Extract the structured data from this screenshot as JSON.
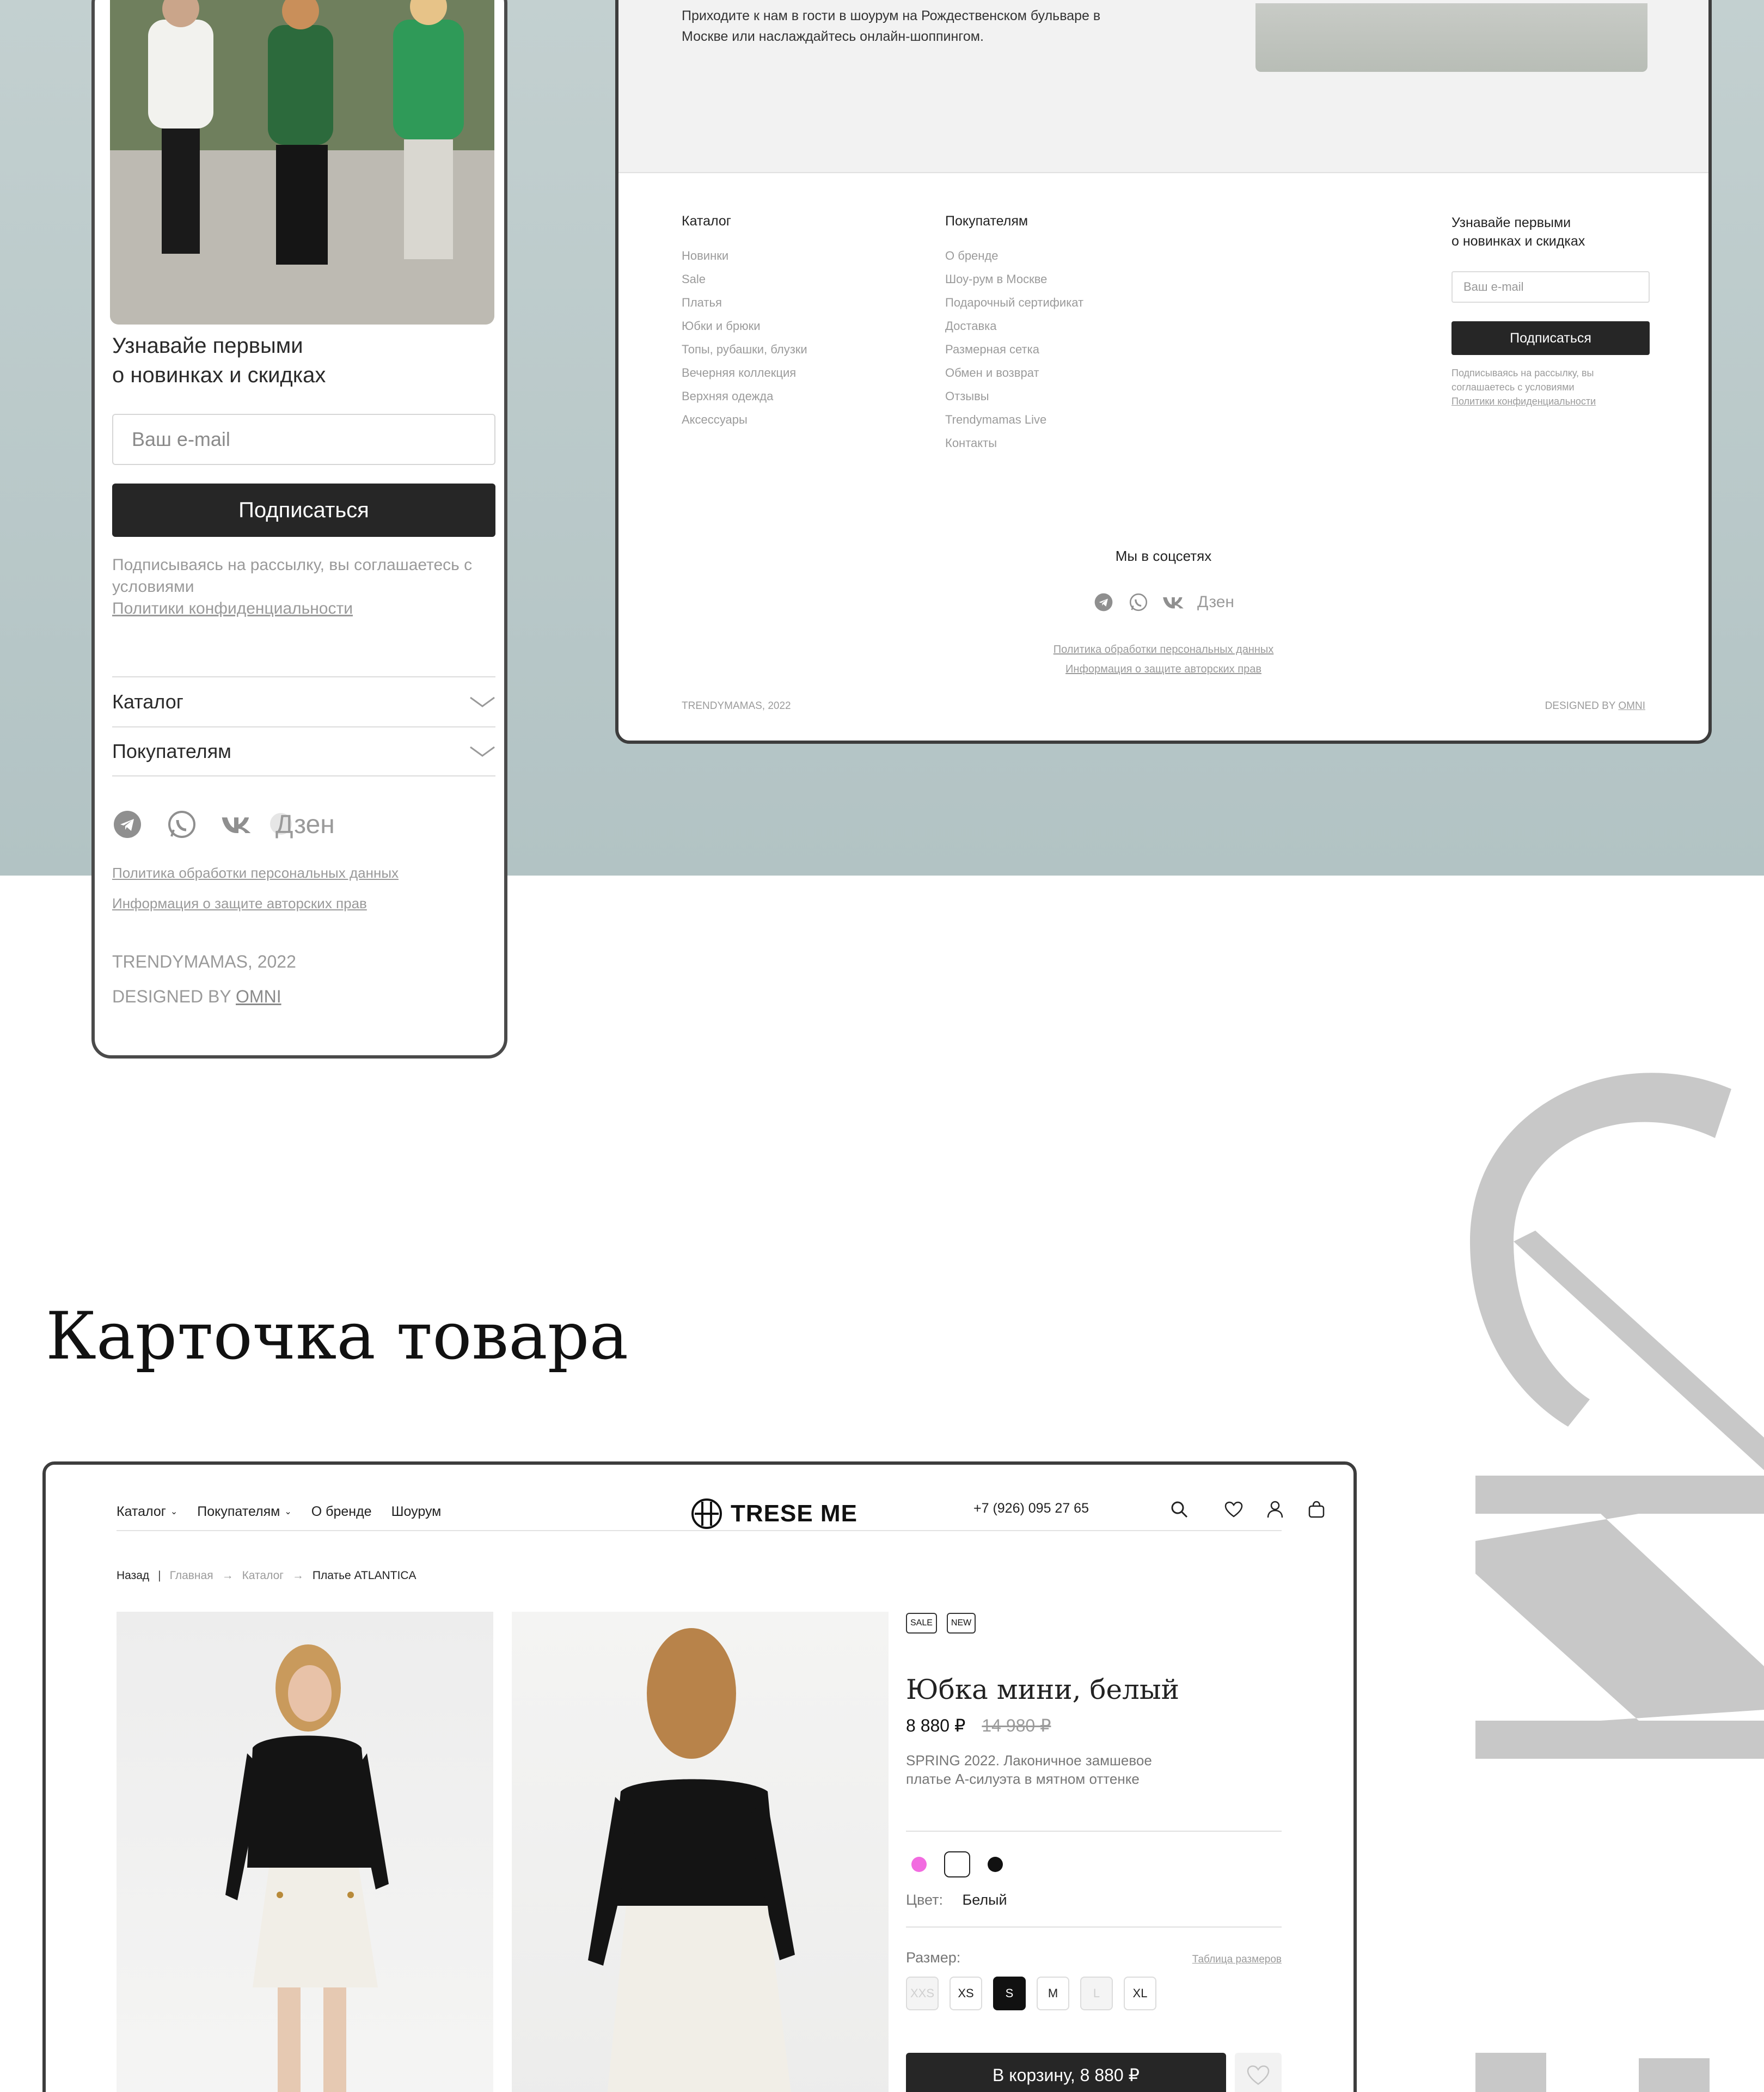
{
  "mobile": {
    "subscribe_title": "Узнавайе первыми\nо новинках и скидках",
    "email_placeholder": "Ваш e-mail",
    "subscribe_button": "Подписаться",
    "note_text": "Подписываясь на рассылку, вы соглашаетесь с условиями",
    "note_link": "Политики конфиденциальности",
    "accordion": [
      "Каталог",
      "Покупателям"
    ],
    "social_dzen": "Дзен",
    "links": [
      "Политика обработки персональных данных",
      "Информация о защите авторских прав"
    ],
    "copyright": "TRENDYMAMAS, 2022",
    "designed_by": "DESIGNED BY",
    "designer": "OMNI"
  },
  "desktop_footer": {
    "intro": "Приходите к нам в гости в шоурум на Рождественском бульваре в Москве или наслаждайтесь онлайн-шоппингом.",
    "catalog_title": "Каталог",
    "catalog_items": [
      "Новинки",
      "Sale",
      "Платья",
      "Юбки и брюки",
      "Топы, рубашки, блузки",
      "Вечерняя коллекция",
      "Верхняя одежда",
      "Аксессуары"
    ],
    "buyers_title": "Покупателям",
    "buyers_items": [
      "О бренде",
      "Шоу-рум в Москве",
      "Подарочный сертификат",
      "Доставка",
      "Размерная сетка",
      "Обмен и возврат",
      "Отзывы",
      "Trendymamas Live",
      "Контакты"
    ],
    "subscribe_title": "Узнавайе первыми\nо новинках и скидках",
    "email_placeholder": "Ваш e-mail",
    "subscribe_button": "Подписаться",
    "note_text": "Подписываясь на рассылку, вы соглашаетесь с условиями",
    "note_link": "Политики конфиденциальности",
    "social_title": "Мы в соцсетях",
    "social_dzen": "Дзен",
    "links": [
      "Политика обработки персональных данных",
      "Информация о защите авторских прав"
    ],
    "copyright": "TRENDYMAMAS, 2022",
    "designed_by": "DESIGNED BY",
    "designer": "OMNI"
  },
  "section_title": "Карточка товара",
  "product_page": {
    "nav": {
      "items": [
        "Каталог",
        "Покупателям",
        "О бренде",
        "Шоурум"
      ],
      "logo": "TRESE ME",
      "phone": "+7 (926) 095 27 65"
    },
    "breadcrumbs": {
      "back": "Назад",
      "items": [
        "Главная",
        "Каталог"
      ],
      "current": "Платье ATLANTICA"
    },
    "badges": [
      "SALE",
      "NEW"
    ],
    "name": "Юбка мини, белый",
    "price": "8 880 ₽",
    "old_price": "14 980 ₽",
    "description": "SPRING 2022. Лаконичное замшевое платье А-силуэта в мятном оттенке",
    "colors": [
      {
        "name": "pink",
        "hex": "#f26be0"
      },
      {
        "name": "white",
        "hex": "#ffffff"
      },
      {
        "name": "black",
        "hex": "#111111"
      }
    ],
    "color_label": "Цвет:",
    "color_value": "Белый",
    "size_label": "Размер:",
    "size_table": "Таблица размеров",
    "sizes": [
      "XXS",
      "XS",
      "S",
      "M",
      "L",
      "XL"
    ],
    "selected_size": "S",
    "disabled_sizes": [
      "XXS",
      "L"
    ],
    "cart_button": "В корзину, 8 880 ₽"
  },
  "colors": {
    "accent_dark": "#262626",
    "band": "#b9c8c8",
    "muted": "#9b9b9b"
  }
}
